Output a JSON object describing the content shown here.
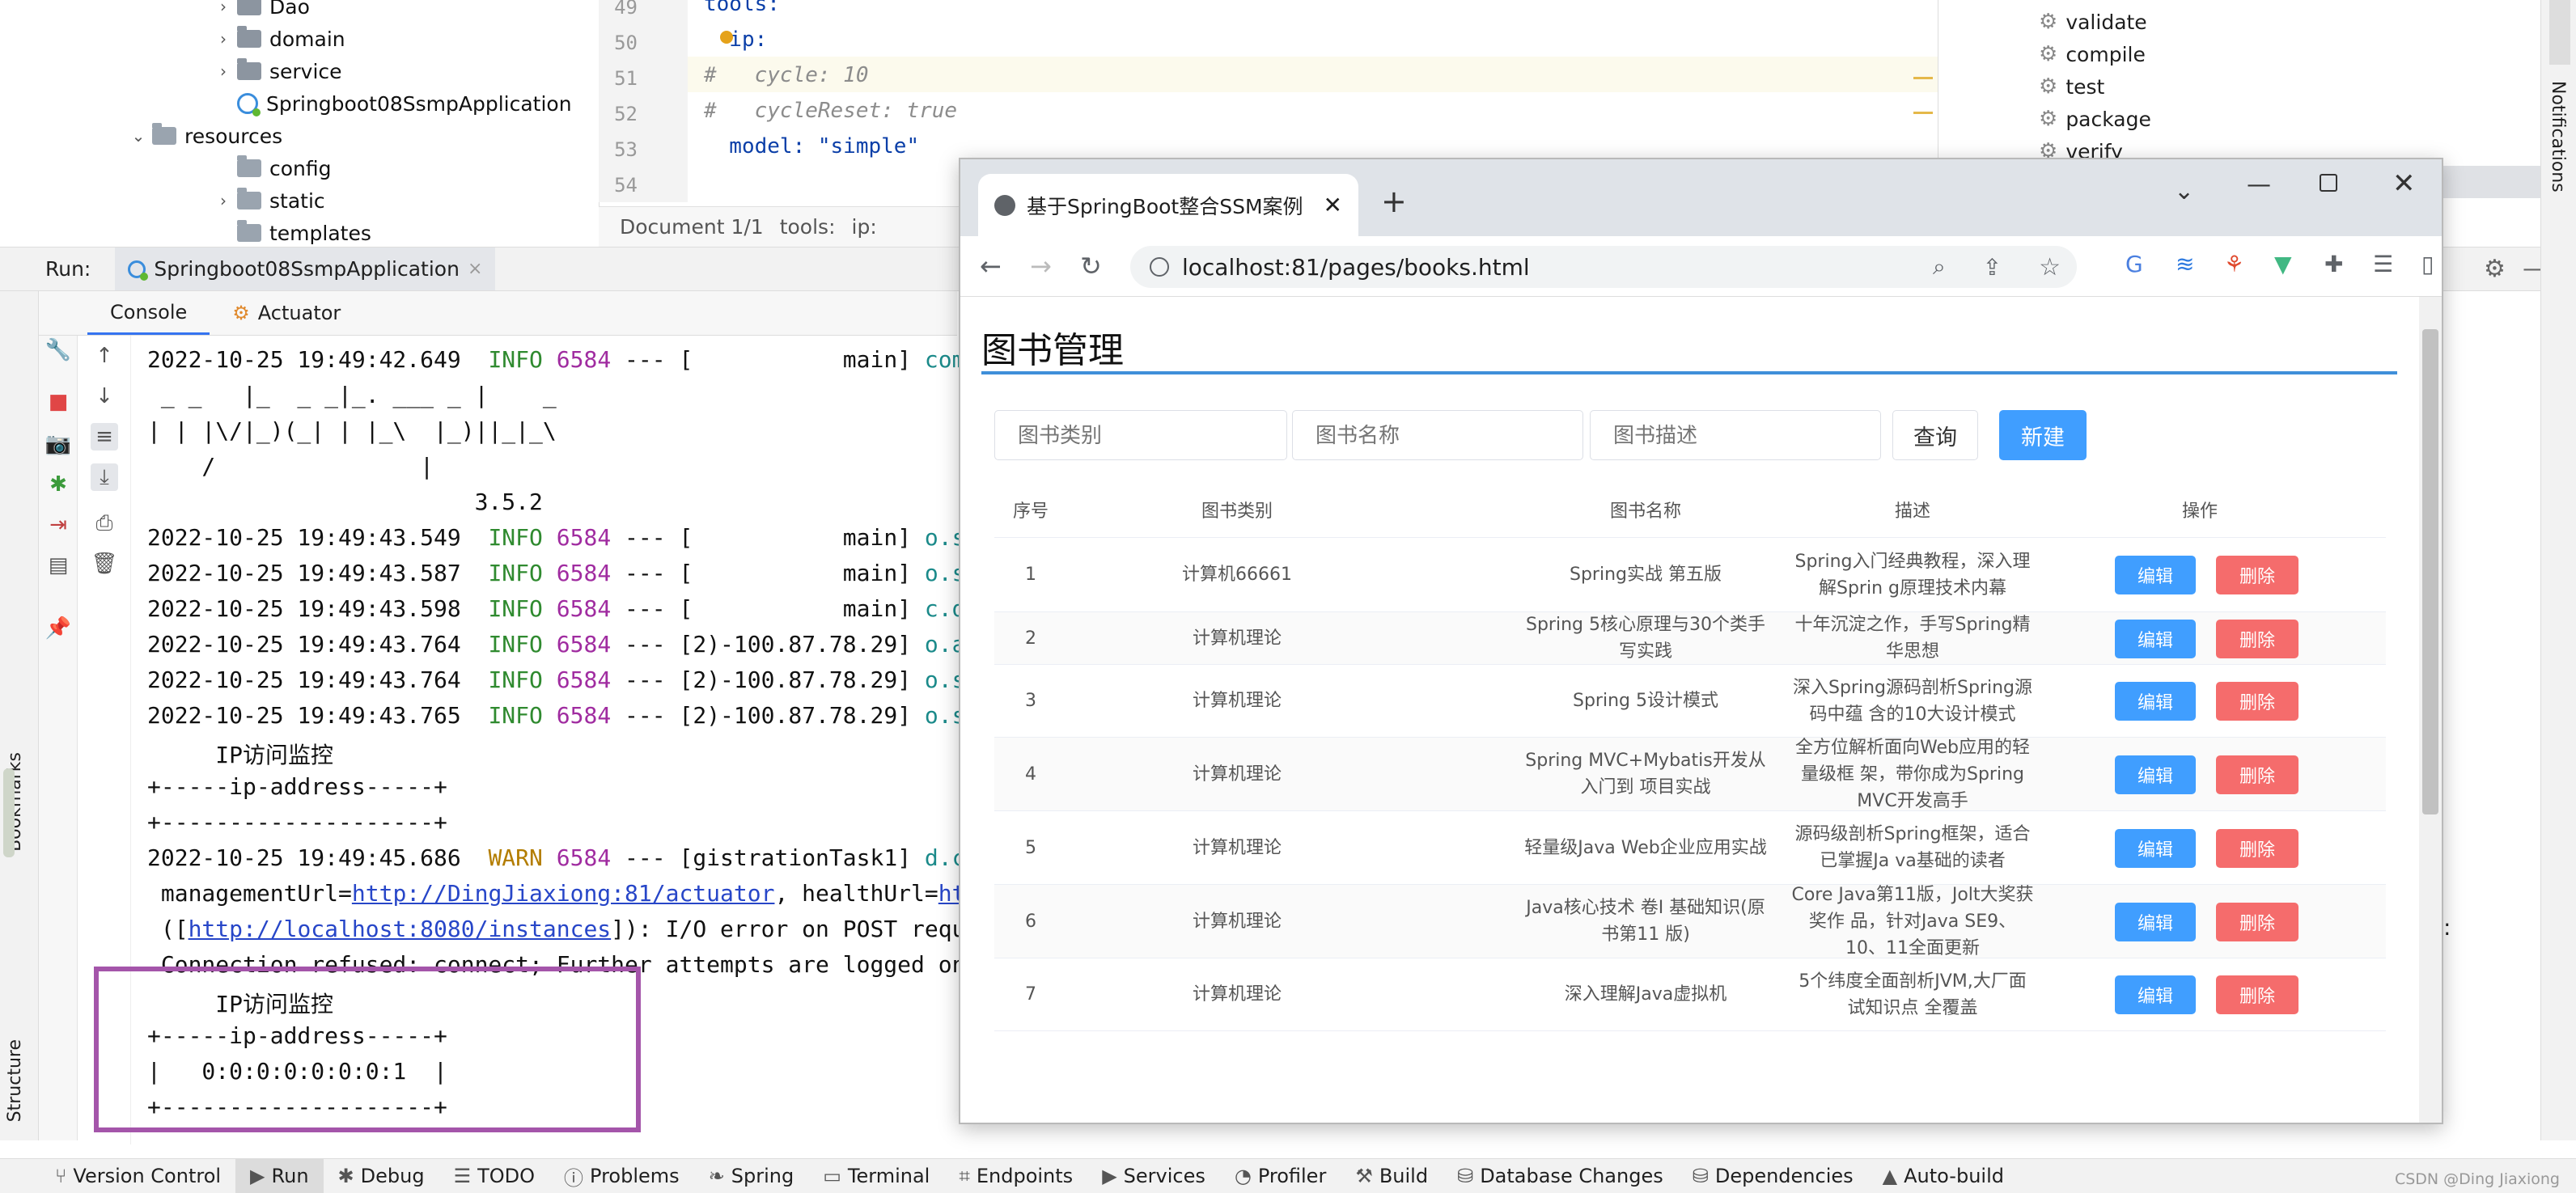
{
  "ide": {
    "tree": [
      {
        "label": "Dao",
        "indent": 1,
        "type": "pkg",
        "chev": true
      },
      {
        "label": "domain",
        "indent": 1,
        "type": "pkg",
        "chev": true
      },
      {
        "label": "service",
        "indent": 1,
        "type": "pkg",
        "chev": true
      },
      {
        "label": "Springboot08SsmpApplication",
        "indent": 1,
        "type": "app",
        "chev": false
      },
      {
        "label": "resources",
        "indent": 0,
        "type": "folder",
        "chev": true
      },
      {
        "label": "config",
        "indent": 1,
        "type": "folder",
        "chev": false
      },
      {
        "label": "static",
        "indent": 1,
        "type": "folder",
        "chev": true
      },
      {
        "label": "templates",
        "indent": 1,
        "type": "folder",
        "chev": false
      }
    ],
    "editor": {
      "lines": [
        {
          "n": "49",
          "code": "tools:"
        },
        {
          "n": "50",
          "code": "  ip:"
        },
        {
          "n": "51",
          "code": "#   cycle: 10"
        },
        {
          "n": "52",
          "code": "#   cycleReset: true"
        },
        {
          "n": "53",
          "code": "  model: \"simple\""
        },
        {
          "n": "54",
          "code": ""
        }
      ],
      "breadcrumb": [
        "Document 1/1",
        "tools:",
        "ip:"
      ]
    },
    "maven": [
      "validate",
      "compile",
      "test",
      "package",
      "verify"
    ],
    "run_label": "Run:",
    "run_tab": "Springboot08SsmpApplication",
    "console_tabs": [
      "Console",
      "Actuator"
    ],
    "console": [
      {
        "ts": "2022-10-25 19:49:42.649",
        "level": "INFO",
        "pid": "6584",
        "rest": " --- [           main] ",
        "logger": "com.al"
      },
      {
        "raw": " _ _   |_  _ _|_. ___ _ |    _"
      },
      {
        "raw": "| | |\\/|_)(_| | |_\\  |_)||_|_\\"
      },
      {
        "raw": "    /               |"
      },
      {
        "raw": "                        3.5.2"
      },
      {
        "ts": "2022-10-25 19:49:43.549",
        "level": "INFO",
        "pid": "6584",
        "rest": " --- [           main] ",
        "logger": "o.s.b."
      },
      {
        "ts": "2022-10-25 19:49:43.587",
        "level": "INFO",
        "pid": "6584",
        "rest": " --- [           main] ",
        "logger": "o.s.b."
      },
      {
        "ts": "2022-10-25 19:49:43.598",
        "level": "INFO",
        "pid": "6584",
        "rest": " --- [           main] ",
        "logger": "c.d.Sp"
      },
      {
        "ts": "2022-10-25 19:49:43.764",
        "level": "INFO",
        "pid": "6584",
        "rest": " --- [2)-100.87.78.29] ",
        "logger": "o.a.c."
      },
      {
        "ts": "2022-10-25 19:49:43.764",
        "level": "INFO",
        "pid": "6584",
        "rest": " --- [2)-100.87.78.29] ",
        "logger": "o.s.we"
      },
      {
        "ts": "2022-10-25 19:49:43.765",
        "level": "INFO",
        "pid": "6584",
        "rest": " --- [2)-100.87.78.29] ",
        "logger": "o.s.we"
      },
      {
        "raw": "     IP访问监控"
      },
      {
        "raw": "+-----ip-address-----+"
      },
      {
        "raw": "+--------------------+"
      },
      {
        "ts": "2022-10-25 19:49:45.686",
        "level": "WARN",
        "pid": "6584",
        "rest": " --- [gistrationTask1] ",
        "logger": "d.c.b."
      },
      {
        "mixed": [
          {
            "t": " managementUrl="
          },
          {
            "t": "http://DingJiaxiong:81/actuator",
            "link": true
          },
          {
            "t": ", healthUrl="
          },
          {
            "t": "http:",
            "link": true
          }
        ]
      },
      {
        "mixed": [
          {
            "t": " (["
          },
          {
            "t": "http://localhost:8080/instances",
            "link": true
          },
          {
            "t": "]): I/O error on POST request"
          }
        ]
      },
      {
        "raw": " Connection refused: connect; Further attempts are logged on DE"
      },
      {
        "raw": "     IP访问监控"
      },
      {
        "raw": "+-----ip-address-----+"
      },
      {
        "raw": "|   0:0:0:0:0:0:0:1  |"
      },
      {
        "raw": "+--------------------+"
      }
    ],
    "bottom_tabs": [
      "Version Control",
      "Run",
      "Debug",
      "TODO",
      "Problems",
      "Spring",
      "Terminal",
      "Endpoints",
      "Services",
      "Profiler",
      "Build",
      "Database Changes",
      "Dependencies",
      "Auto-build"
    ],
    "side_labels": [
      "Bookmarks",
      "Structure"
    ],
    "right_side_label": "Notifications",
    "watermark": "CSDN @Ding Jiaxiong"
  },
  "browser": {
    "tab_title": "基于SpringBoot整合SSM案例",
    "url": "localhost:81/pages/books.html",
    "page": {
      "title": "图书管理",
      "filters": {
        "type": "图书类别",
        "name": "图书名称",
        "desc": "图书描述"
      },
      "query_label": "查询",
      "new_label": "新建",
      "columns": [
        "序号",
        "图书类别",
        "图书名称",
        "描述",
        "操作"
      ],
      "rows": [
        {
          "no": "1",
          "type": "计算机66661",
          "name": "Spring实战 第五版",
          "desc": "Spring入门经典教程，深入理解Sprin g原理技术内幕"
        },
        {
          "no": "2",
          "type": "计算机理论",
          "name": "Spring 5核心原理与30个类手写实践",
          "desc": "十年沉淀之作，手写Spring精华思想"
        },
        {
          "no": "3",
          "type": "计算机理论",
          "name": "Spring 5设计模式",
          "desc": "深入Spring源码剖析Spring源码中蕴 含的10大设计模式"
        },
        {
          "no": "4",
          "type": "计算机理论",
          "name": "Spring MVC+Mybatis开发从入门到 项目实战",
          "desc": "全方位解析面向Web应用的轻量级框 架，带你成为Spring MVC开发高手"
        },
        {
          "no": "5",
          "type": "计算机理论",
          "name": "轻量级Java Web企业应用实战",
          "desc": "源码级剖析Spring框架，适合已掌握Ja va基础的读者"
        },
        {
          "no": "6",
          "type": "计算机理论",
          "name": "Java核心技术 卷Ⅰ 基础知识(原书第11 版)",
          "desc": "Core Java第11版，Jolt大奖获奖作 品，针对Java SE9、10、11全面更新"
        },
        {
          "no": "7",
          "type": "计算机理论",
          "name": "深入理解Java虚拟机",
          "desc": "5个纬度全面剖析JVM,大厂面试知识点 全覆盖"
        }
      ],
      "edit_label": "编辑",
      "delete_label": "删除"
    }
  },
  "colors": {
    "primary": "#409eff",
    "danger": "#f56c6c",
    "highlight_box": "#a455aa",
    "accent_line": "#3f8fd9"
  }
}
